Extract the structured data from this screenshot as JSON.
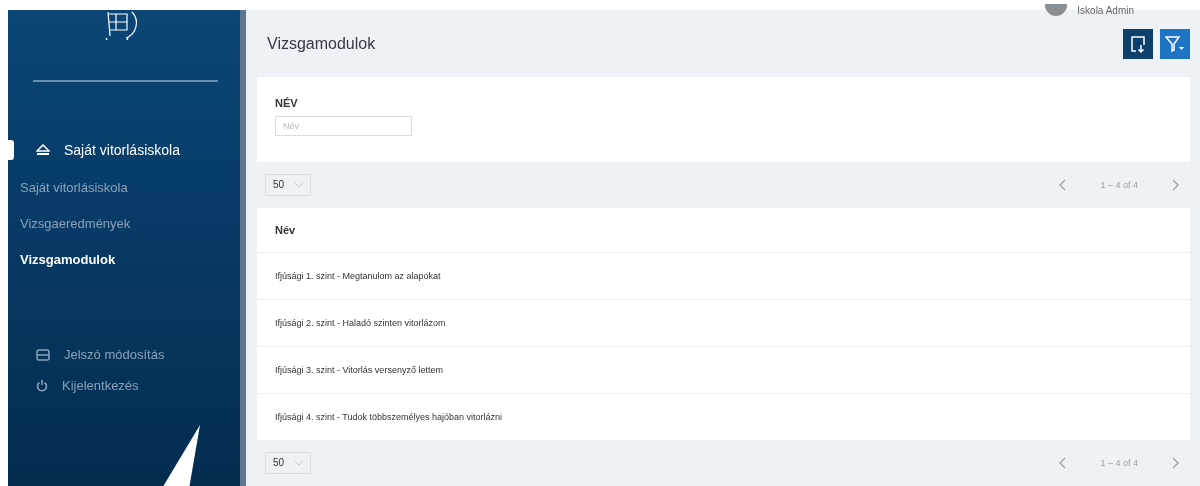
{
  "user": {
    "name": "Iskola Admin"
  },
  "sidebar": {
    "section": {
      "label": "Saját vitorlásiskola",
      "active": true
    },
    "items": [
      {
        "label": "Saját vitorlásiskola",
        "selected": false
      },
      {
        "label": "Vizsgaeredmények",
        "selected": false
      },
      {
        "label": "Vizsgamodulok",
        "selected": true
      }
    ],
    "account": [
      {
        "kind": "password",
        "label": "Jelszó módosítás"
      },
      {
        "kind": "logout",
        "label": "Kijelentkezés"
      }
    ]
  },
  "page": {
    "title": "Vizsgamodulok"
  },
  "filter": {
    "label": "NÉV",
    "placeholder": "Név"
  },
  "pagination_top": {
    "page_size": "50",
    "range": "1 – 4 of 4"
  },
  "table": {
    "columns": [
      "Név"
    ],
    "rows": [
      {
        "name": "Ifjúsági 1. szint - Megtanulom az alapokat"
      },
      {
        "name": "Ifjúsági 2. szint - Haladó szinten vitorlázom"
      },
      {
        "name": "Ifjúsági 3. szint - Vitorlás versenyző lettem"
      },
      {
        "name": "Ifjúsági 4. szint - Tudok többszemélyes hajóban vitorlázni"
      }
    ]
  },
  "pagination_bottom": {
    "page_size": "50",
    "range": "1 – 4 of 4"
  }
}
